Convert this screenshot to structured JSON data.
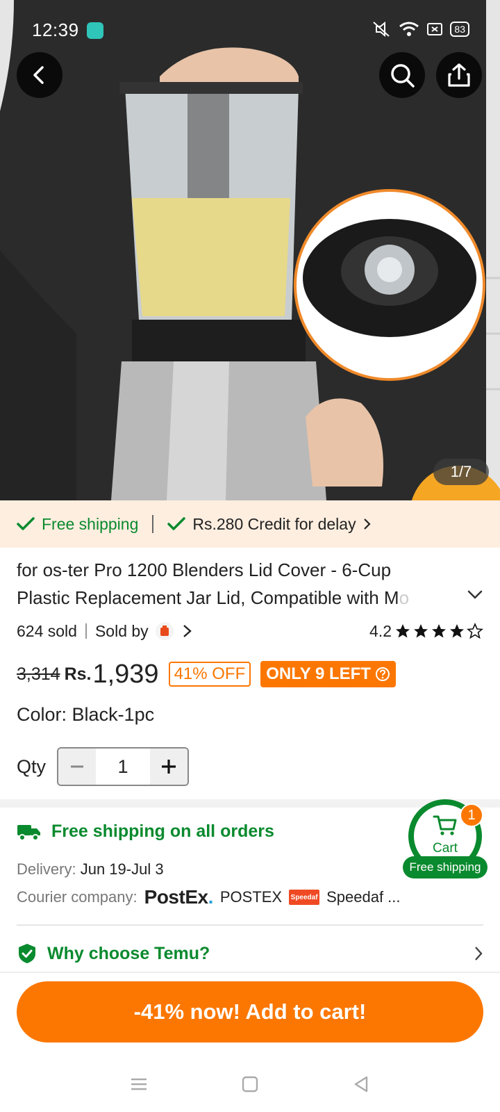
{
  "status": {
    "time": "12:39",
    "battery": "83"
  },
  "gallery": {
    "pager": "1/7"
  },
  "shipping_strip": {
    "free_shipping": "Free shipping",
    "credit": "Rs.280 Credit for delay"
  },
  "product": {
    "title_line1": "for os-ter Pro 1200 Blenders Lid Cover - 6-Cup",
    "title_line2": "Plastic Replacement Jar Lid, Compatible with M",
    "title_fade": "o",
    "sold": "624 sold",
    "sold_by": "Sold by",
    "rating": "4.2",
    "stars_filled": 4,
    "stars_total": 5
  },
  "price": {
    "old": "3,314",
    "currency": "Rs.",
    "current": "1,939",
    "discount": "41% OFF",
    "stock": "ONLY 9 LEFT"
  },
  "options": {
    "color_label": "Color:",
    "color_value": "Black-1pc",
    "qty_label": "Qty",
    "qty_value": "1"
  },
  "delivery": {
    "headline": "Free shipping on all orders",
    "delivery_label": "Delivery:",
    "delivery_value": "Jun 19-Jul 3",
    "courier_label": "Courier company:",
    "courier1_logo": "PostEx",
    "courier1_logo_dot": ".",
    "courier1_name": "POSTEX",
    "courier2_logo": "Speedaf",
    "courier2_name": "Speedaf ..."
  },
  "cart": {
    "label": "Cart",
    "count": "1",
    "free": "Free shipping"
  },
  "why": {
    "label": "Why choose Temu?"
  },
  "cta": {
    "label": "-41% now! Add to cart!"
  },
  "colors": {
    "accent": "#fb7701",
    "green": "#0a8a2e",
    "strip_bg": "#fdeee0"
  }
}
